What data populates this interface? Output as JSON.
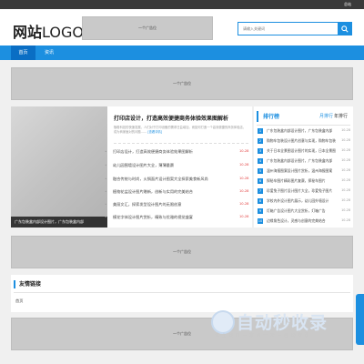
{
  "topbar": {
    "right_text": "总站"
  },
  "header": {
    "logo_strong": "网站",
    "logo_light": "LOGO",
    "ad_label": "一个广告位",
    "search_placeholder": "请输入关键词",
    "search_icon": "search-icon"
  },
  "nav": {
    "items": [
      {
        "label": "首页",
        "active": true
      },
      {
        "label": "资讯",
        "active": false
      }
    ]
  },
  "ads": {
    "top": "一个广告位",
    "middle": "一个广告位",
    "bottom": "一个广告位"
  },
  "slider": {
    "caption": "广东包装盒内部设计图片，广东包装盒内部"
  },
  "featured": {
    "title": "打印店设计，打造高效便捷商务体验效果图解析",
    "desc": "随着科技的快速发展，人们对于打印设备的需求日益增加，而如何打造一个高效便捷的商务体验店，成为商家面对的问题……",
    "more": "[查看详情]"
  },
  "news": [
    {
      "title": "打印店设计，打造高效便捷商务体验效果图解析",
      "date": "10-28"
    },
    {
      "title": "幼儿园围墙设计图片大全，薄薄量赛",
      "date": "10-28"
    },
    {
      "title": "融合传统与时尚，火锅面片设计图案大全探索美食新风尚",
      "date": "10-28"
    },
    {
      "title": "植物花盆设计图片赠新，创新与实用的完美结合",
      "date": "10-28"
    },
    {
      "title": "美丽文汇，探索发型设计图片的无限创意",
      "date": "10-28"
    },
    {
      "title": "模花字体设计图片赏析，精致与优雅的视觉盛宴",
      "date": "10-28"
    }
  ],
  "rank": {
    "title": "排行榜",
    "tab_a": "月排行",
    "tab_b": "年排行",
    "items": [
      {
        "title": "广东包装盒内部设计图片，广东包装盒内部",
        "date": "10-28"
      },
      {
        "title": "购物车包装设计图片创意与实现，购物车包装",
        "date": "10-28"
      },
      {
        "title": "关于日本全景图设计图片的实现，日本全景图",
        "date": "10-28"
      },
      {
        "title": "广东包装盒内部设计图片，广东包装盒内部",
        "date": "10-28"
      },
      {
        "title": "温州海报图案设计图片赏析，温州海报图案",
        "date": "10-28"
      },
      {
        "title": "探秘车图片精彩图片复赛，探秘车图片",
        "date": "10-28"
      },
      {
        "title": "珍爱兔子图片设计图片大全，珍爱兔子图片",
        "date": "10-28"
      },
      {
        "title": "学校内外设计图片展示，幼儿园外墙设计",
        "date": "10-28"
      },
      {
        "title": "灯箱广告设计图片大全赏析，灯箱广告",
        "date": "10-28"
      },
      {
        "title": "边缘角色设计，灵感与创意的完美结合",
        "date": "10-28"
      }
    ]
  },
  "links": {
    "title": "友情链接",
    "items": [
      "首页"
    ]
  },
  "watermark": {
    "title": "自动秒收录",
    "subtitle": "做 上 链 接 — 来 访 一 次 — 自 动 收 录"
  },
  "colors": {
    "accent": "#1c8fe0",
    "date_red": "#e23c3c",
    "topbar": "#3a3a3a"
  }
}
